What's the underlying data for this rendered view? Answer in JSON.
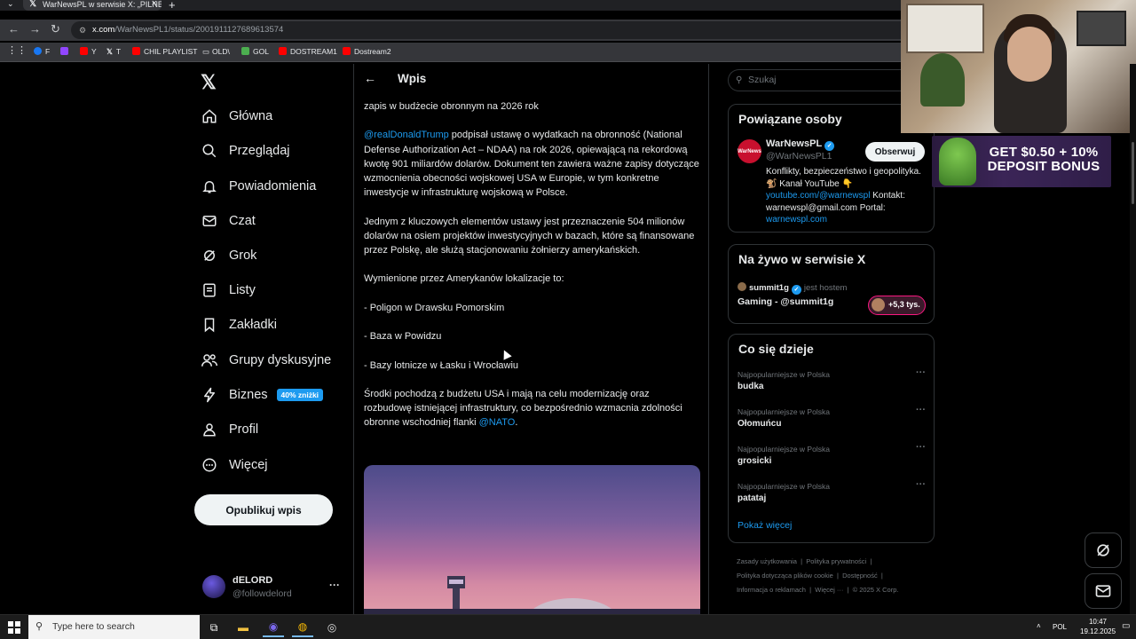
{
  "browser": {
    "tab_title": "WarNewsPL w serwisie X: „PILNE",
    "url_host": "x.com",
    "url_path": "/WarNewsPL1/status/2001911127689613574",
    "bookmarks": [
      {
        "label": "F",
        "color": "#1877f2"
      },
      {
        "label": "",
        "color": "#9146ff"
      },
      {
        "label": "Y",
        "color": "#ff0000"
      },
      {
        "label": "T",
        "color": "#e7e9ea"
      },
      {
        "label": "CHIL PLAYLIST",
        "color": "#ff0000"
      },
      {
        "label": "OLD\\",
        "color": "#e8eaed"
      },
      {
        "label": "GOL",
        "color": "#4caf50"
      },
      {
        "label": "DOSTREAM1",
        "color": "#ff0000"
      },
      {
        "label": "Dostream2",
        "color": "#ff0000"
      }
    ]
  },
  "nav": {
    "items": [
      {
        "label": "Główna",
        "icon": "home-icon"
      },
      {
        "label": "Przeglądaj",
        "icon": "search-icon"
      },
      {
        "label": "Powiadomienia",
        "icon": "bell-icon"
      },
      {
        "label": "Czat",
        "icon": "mail-icon"
      },
      {
        "label": "Grok",
        "icon": "grok-icon"
      },
      {
        "label": "Listy",
        "icon": "list-icon"
      },
      {
        "label": "Zakładki",
        "icon": "bookmark-icon"
      },
      {
        "label": "Grupy dyskusyjne",
        "icon": "people-icon"
      },
      {
        "label": "Biznes",
        "icon": "lightning-icon"
      },
      {
        "label": "Profil",
        "icon": "person-icon"
      },
      {
        "label": "Więcej",
        "icon": "more-circle-icon"
      }
    ],
    "promo_badge": "40% zniżki",
    "post_button": "Opublikuj wpis",
    "user_name": "dELORD",
    "user_handle": "@followdelord",
    "user_more": "···"
  },
  "post": {
    "header_title": "Wpis",
    "lead_line": "zapis w budżecie obronnym na 2026 rok",
    "p1_mention": "@realDonaldTrump",
    "p1_text": " podpisał ustawę o wydatkach na obronność (National Defense Authorization Act – NDAA) na rok 2026, opiewającą na rekordową kwotę 901 miliardów dolarów. Dokument ten zawiera ważne zapisy dotyczące wzmocnienia obecności wojskowej USA w Europie, w tym konkretne inwestycje w infrastrukturę wojskową w Polsce.",
    "p2": "Jednym z kluczowych elementów ustawy jest przeznaczenie 504 milionów dolarów na osiem projektów inwestycyjnych w bazach, które są finansowane przez Polskę, ale służą stacjonowaniu żołnierzy amerykańskich.",
    "p3": "Wymienione przez Amerykanów lokalizacje to:",
    "loc1": "- Poligon w Drawsku Pomorskim",
    "loc2": "- Baza w Powidzu",
    "loc3": "- Bazy lotnicze w Łasku i  Wrocławiu",
    "p4_text": "Środki pochodzą z budżetu USA i mają na celu modernizację oraz rozbudowę istniejącej infrastruktury, co bezpośrednio wzmacnia zdolności obronne wschodniej flanki ",
    "p4_mention": "@NATO",
    "p4_end": "."
  },
  "sidebar": {
    "search_placeholder": "Szukaj",
    "related_title": "Powiązane osoby",
    "related_avatar_text": "WarNews",
    "related_name": "WarNewsPL",
    "related_handle": "@WarNewsPL1",
    "follow_button": "Obserwuj",
    "bio_text": "Konflikty, bezpieczeństwo i geopolityka. 🐒 Kanał YouTube 👇",
    "bio_link1": "youtube.com/@warnewspl",
    "bio_contact": " Kontakt: warnewspl@gmail.com Portal: ",
    "bio_link2": "warnewspl.com",
    "live_title": "Na żywo w serwisie X",
    "live_host": "summit1g",
    "live_host_role": "jest hostem",
    "live_stream_title": "Gaming - @summit1g",
    "live_count": "+5,3 tys.",
    "trends_title": "Co się dzieje",
    "trends": [
      {
        "context": "Najpopularniejsze w Polska",
        "name": "budka"
      },
      {
        "context": "Najpopularniejsze w Polska",
        "name": "Ołomuńcu"
      },
      {
        "context": "Najpopularniejsze w Polska",
        "name": "grosicki"
      },
      {
        "context": "Najpopularniejsze w Polska",
        "name": "patataj"
      }
    ],
    "trend_more": "···",
    "show_more": "Pokaż więcej",
    "footer": {
      "terms": "Zasady użytkowania",
      "privacy": "Polityka prywatności",
      "cookies": "Polityka dotycząca plików cookie",
      "accessibility": "Dostępność",
      "ads": "Informacja o reklamach",
      "more": "Więcej ···",
      "copyright": "© 2025 X Corp."
    }
  },
  "overlay": {
    "ad_text": "GET $0.50 + 10% DEPOSIT BONUS"
  },
  "taskbar": {
    "search_placeholder": "Type here to search",
    "lang": "POL",
    "time": "10:47",
    "date": "19.12.2025"
  }
}
